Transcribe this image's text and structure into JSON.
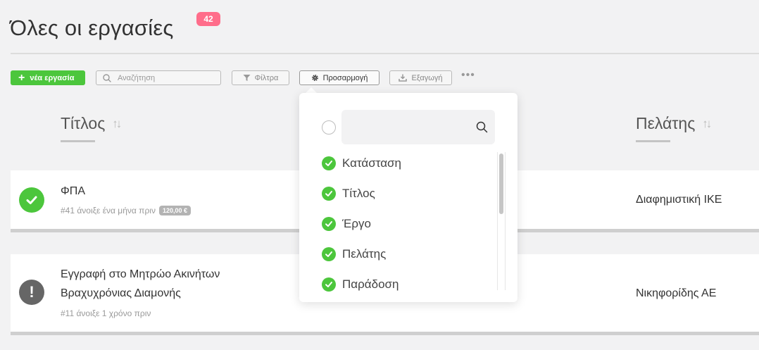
{
  "header": {
    "title": "Όλες οι εργασίες",
    "count": "42"
  },
  "toolbar": {
    "new_task_label": "νέα εργασία",
    "search_placeholder": "Αναζήτηση",
    "filters_label": "Φίλτρα",
    "customize_label": "Προσαρμογή",
    "export_label": "Εξαγωγή",
    "more_label": "•••"
  },
  "columns": {
    "title": "Τίτλος",
    "client": "Πελάτης"
  },
  "tasks": [
    {
      "title_line1": "ΦΠΑ",
      "meta": "#41 άνοιξε ένα μήνα πριν",
      "amount": "120,00 €",
      "client": "Διαφημιστική ΙΚΕ",
      "status": "completed"
    },
    {
      "title_line1": "Εγγραφή στο Μητρώο Ακινήτων",
      "title_line2": "Βραχυχρόνιας Διαμονής",
      "meta": "#11 άνοιξε 1 χρόνο πριν",
      "client": "Νικηφορίδης ΑΕ",
      "status": "alert"
    }
  ],
  "customize_panel": {
    "search_value": "",
    "items": [
      {
        "label": "Κατάσταση",
        "checked": true
      },
      {
        "label": "Τίτλος",
        "checked": true
      },
      {
        "label": "Έργο",
        "checked": true
      },
      {
        "label": "Πελάτης",
        "checked": true
      },
      {
        "label": "Παράδοση",
        "checked": true
      }
    ]
  },
  "colors": {
    "accent_green": "#4cc63c",
    "badge_pink": "#ff6d8a",
    "alert_gray": "#666666"
  }
}
